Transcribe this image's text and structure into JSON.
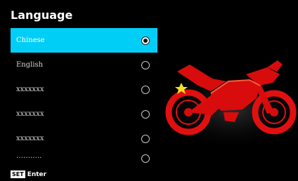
{
  "screen": {
    "title": "Language",
    "options": [
      {
        "label": "Chinese",
        "selected": true
      },
      {
        "label": "English",
        "selected": false
      },
      {
        "label": "xxxxxxx",
        "selected": false
      },
      {
        "label": "xxxxxxx",
        "selected": false
      },
      {
        "label": "xxxxxxx",
        "selected": false
      },
      {
        "label": "………..",
        "selected": false
      }
    ],
    "hint": {
      "key": "SET",
      "action": "Enter"
    },
    "image": "red-motorcycle-illustration"
  },
  "colors": {
    "background": "#000000",
    "highlight": "#00cef6",
    "bike": "#e01010"
  }
}
